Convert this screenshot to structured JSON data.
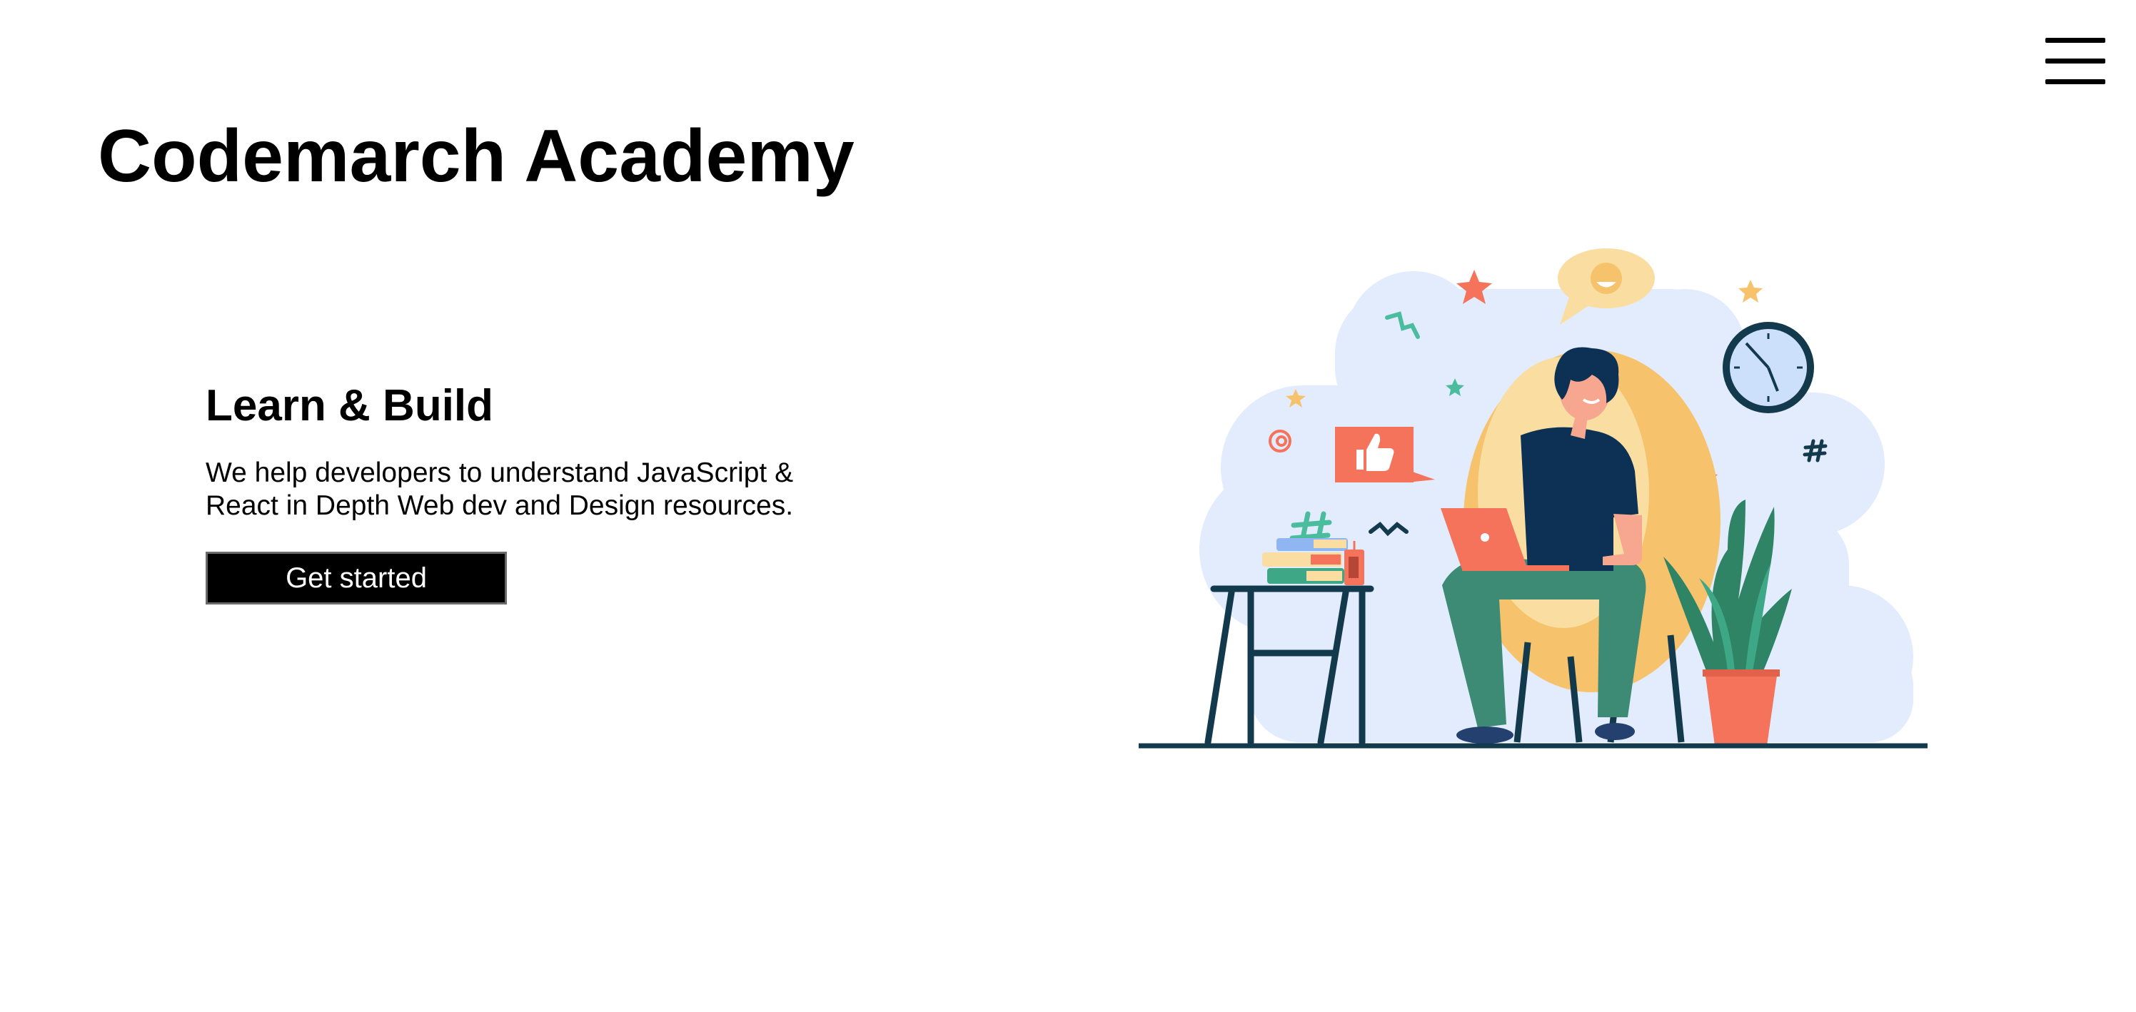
{
  "header": {
    "title": "Codemarch Academy",
    "menu_icon": "hamburger-menu-icon"
  },
  "hero": {
    "heading": "Learn & Build",
    "description": "We help developers to understand JavaScript & React in Depth Web dev and Design resources.",
    "cta_label": "Get started"
  },
  "illustration": {
    "subject": "person-working-on-laptop-illustration",
    "icons": [
      "thumbs-up-icon",
      "clock-icon",
      "smiley-speech-bubble-icon",
      "hashtag-icon",
      "plant-icon",
      "books-icon",
      "star-icon"
    ]
  },
  "colors": {
    "accent": "#f4735a",
    "blob": "#e2ecfd",
    "dark": "#133a4c",
    "green": "#3d8b75",
    "chair": "#f6c26c",
    "button_bg": "#000000",
    "button_text": "#ffffff"
  }
}
